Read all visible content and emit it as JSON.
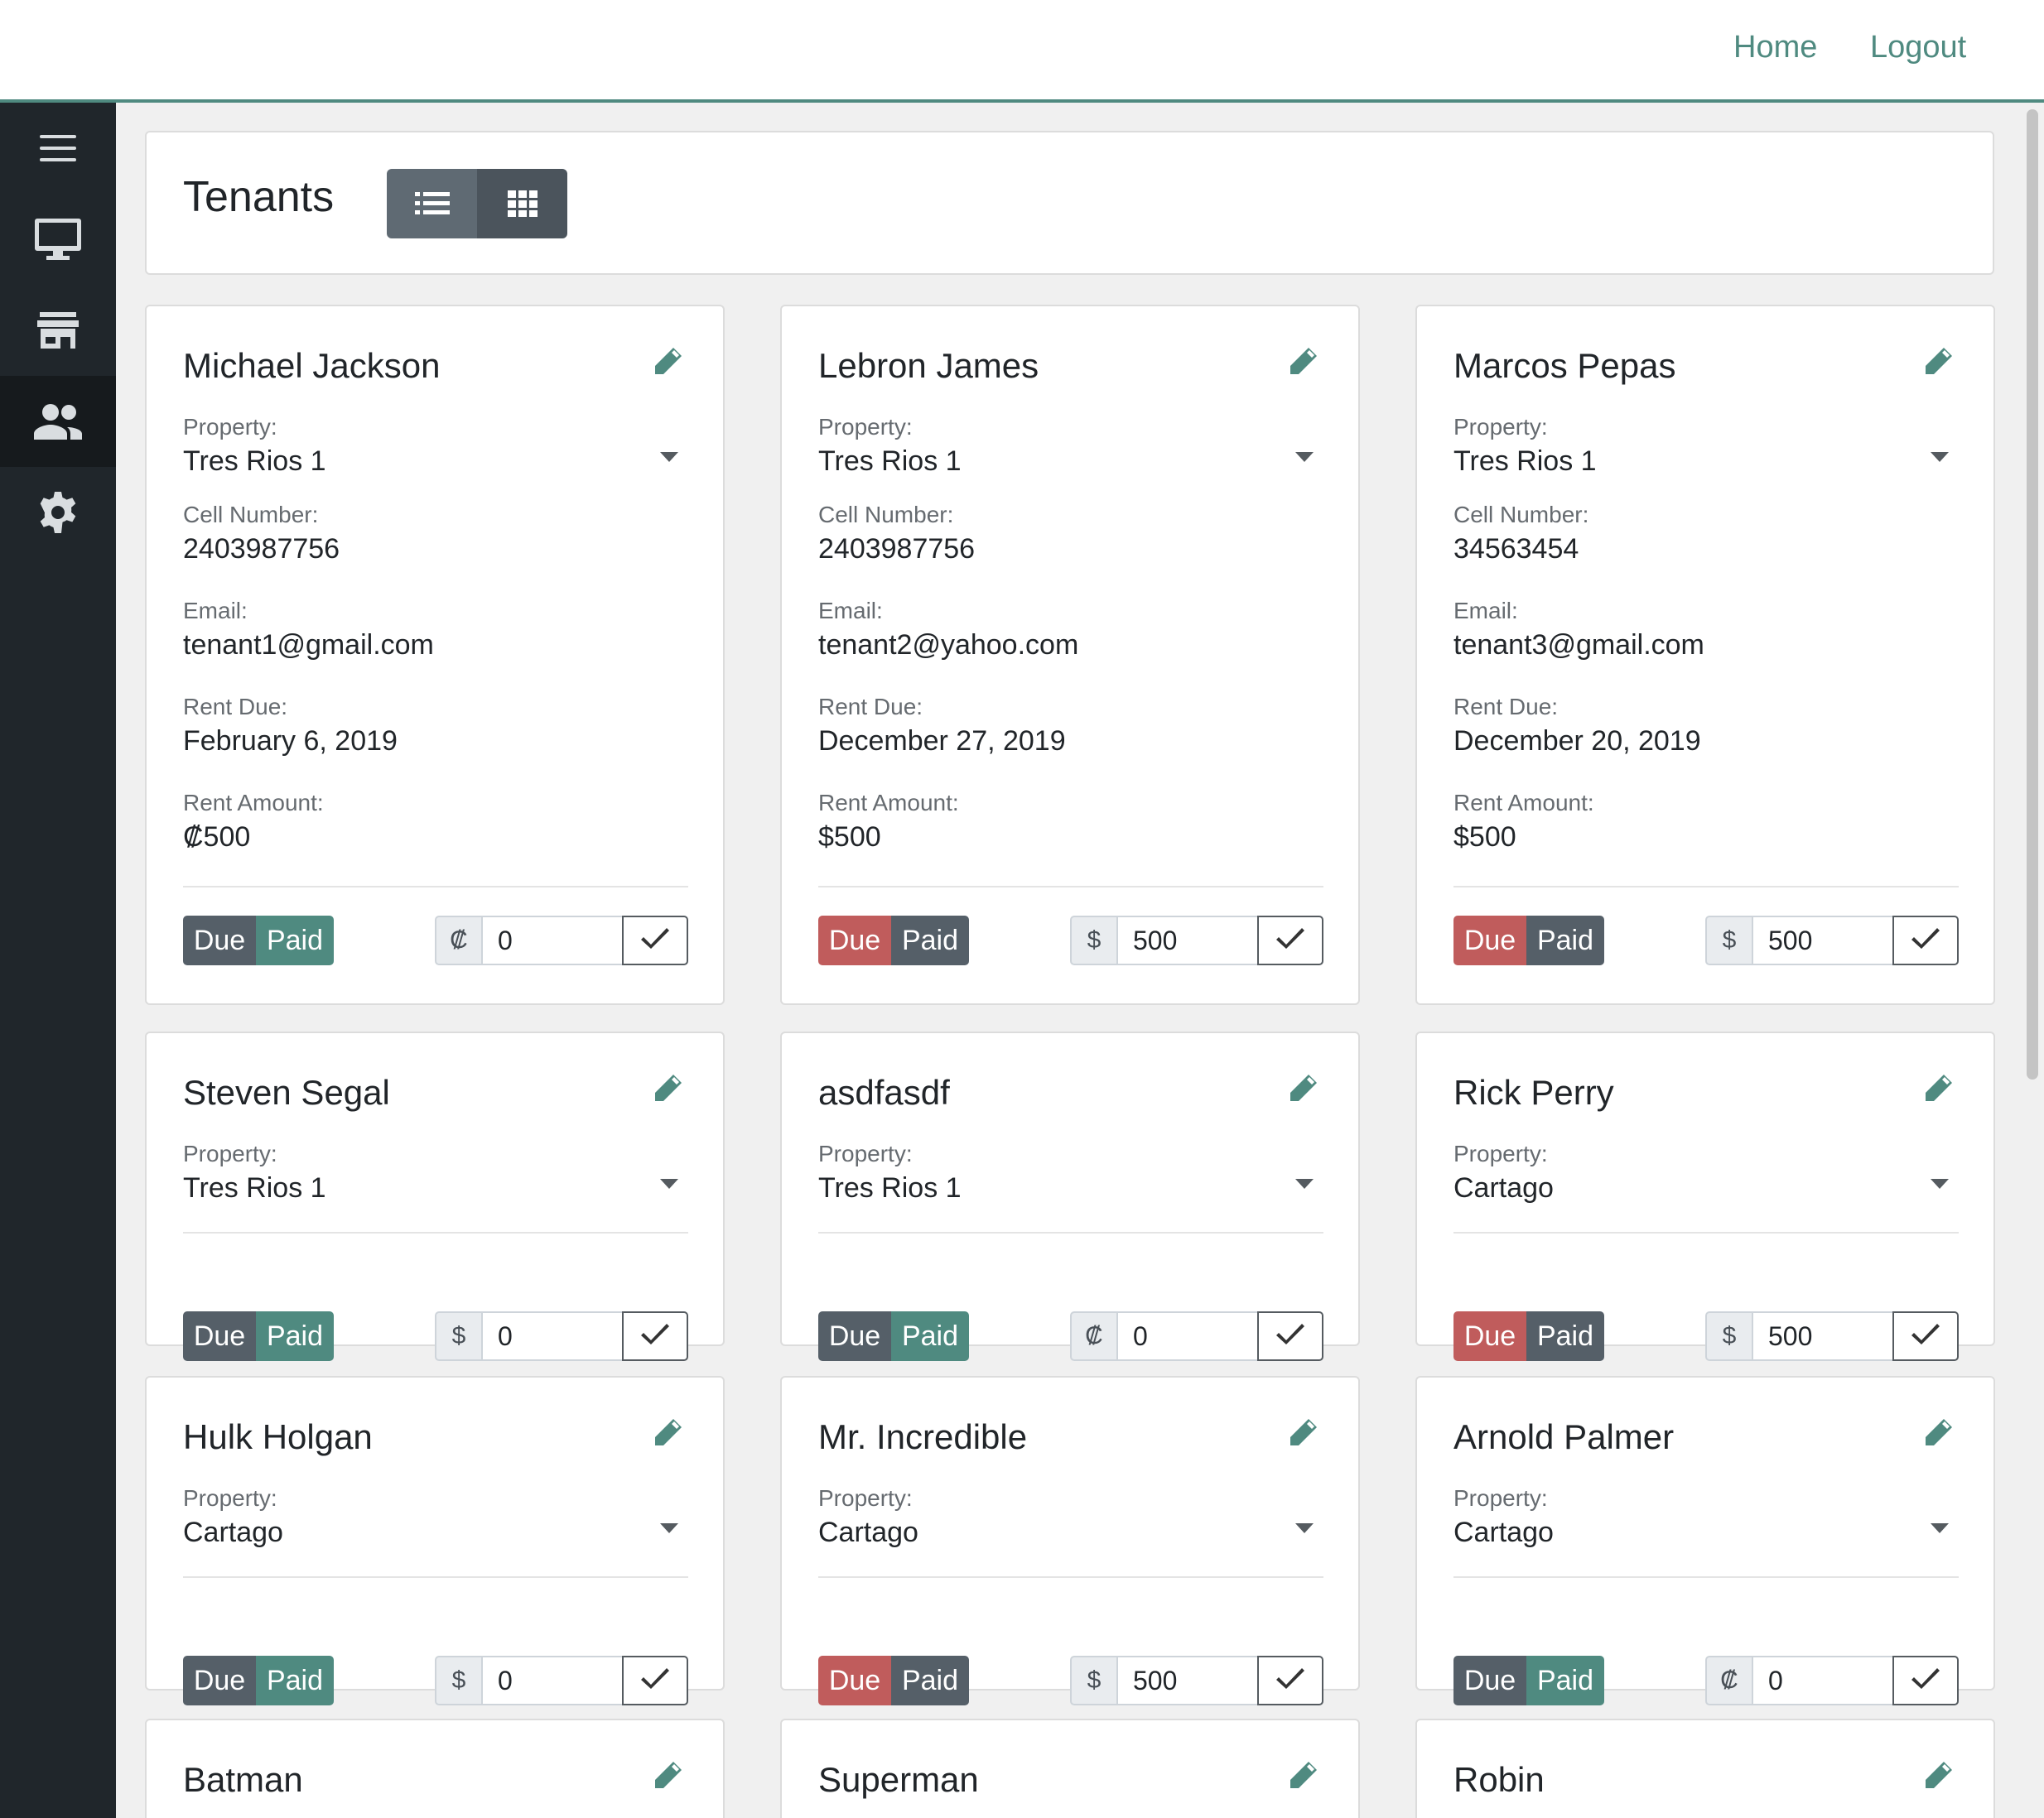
{
  "topbar": {
    "home_label": "Home",
    "logout_label": "Logout",
    "accent": "#4f8a80"
  },
  "sidebar": {
    "items": [
      {
        "icon": "menu-icon",
        "active": false
      },
      {
        "icon": "desktop-icon",
        "active": false
      },
      {
        "icon": "store-icon",
        "active": false
      },
      {
        "icon": "people-icon",
        "active": true
      },
      {
        "icon": "gear-icon",
        "active": false
      }
    ]
  },
  "header": {
    "title": "Tenants",
    "views": [
      {
        "icon": "list-view-icon",
        "active": true
      },
      {
        "icon": "grid-view-icon",
        "active": false
      }
    ]
  },
  "labels": {
    "property": "Property:",
    "cell": "Cell Number:",
    "email": "Email:",
    "rent_due": "Rent Due:",
    "rent_amount": "Rent Amount:",
    "due": "Due",
    "paid": "Paid"
  },
  "colors": {
    "due_active": "#c05c5c",
    "paid_active": "#4f8a80",
    "inactive": "#555f68"
  },
  "tenants": [
    {
      "name": "Michael Jackson",
      "property": "Tres Rios 1",
      "cell": "2403987756",
      "email": "tenant1@gmail.com",
      "rent_due": "February 6, 2019",
      "rent_amount": "₡500",
      "status": "paid",
      "currency": "₡",
      "payment": "0"
    },
    {
      "name": "Lebron James",
      "property": "Tres Rios 1",
      "cell": "2403987756",
      "email": "tenant2@yahoo.com",
      "rent_due": "December 27, 2019",
      "rent_amount": "$500",
      "status": "due",
      "currency": "$",
      "payment": "500"
    },
    {
      "name": "Marcos Pepas",
      "property": "Tres Rios 1",
      "cell": "34563454",
      "email": "tenant3@gmail.com",
      "rent_due": "December 20, 2019",
      "rent_amount": "$500",
      "status": "due",
      "currency": "$",
      "payment": "500"
    },
    {
      "name": "Steven Segal",
      "property": "Tres Rios 1",
      "status": "paid",
      "currency": "$",
      "payment": "0"
    },
    {
      "name": "asdfasdf",
      "property": "Tres Rios 1",
      "status": "paid",
      "currency": "₡",
      "payment": "0"
    },
    {
      "name": "Rick Perry",
      "property": "Cartago",
      "status": "due",
      "currency": "$",
      "payment": "500"
    },
    {
      "name": "Hulk Holgan",
      "property": "Cartago",
      "status": "paid",
      "currency": "$",
      "payment": "0"
    },
    {
      "name": "Mr. Incredible",
      "property": "Cartago",
      "status": "due",
      "currency": "$",
      "payment": "500"
    },
    {
      "name": "Arnold Palmer",
      "property": "Cartago",
      "status": "paid",
      "currency": "₡",
      "payment": "0"
    },
    {
      "name": "Batman"
    },
    {
      "name": "Superman"
    },
    {
      "name": "Robin"
    }
  ]
}
